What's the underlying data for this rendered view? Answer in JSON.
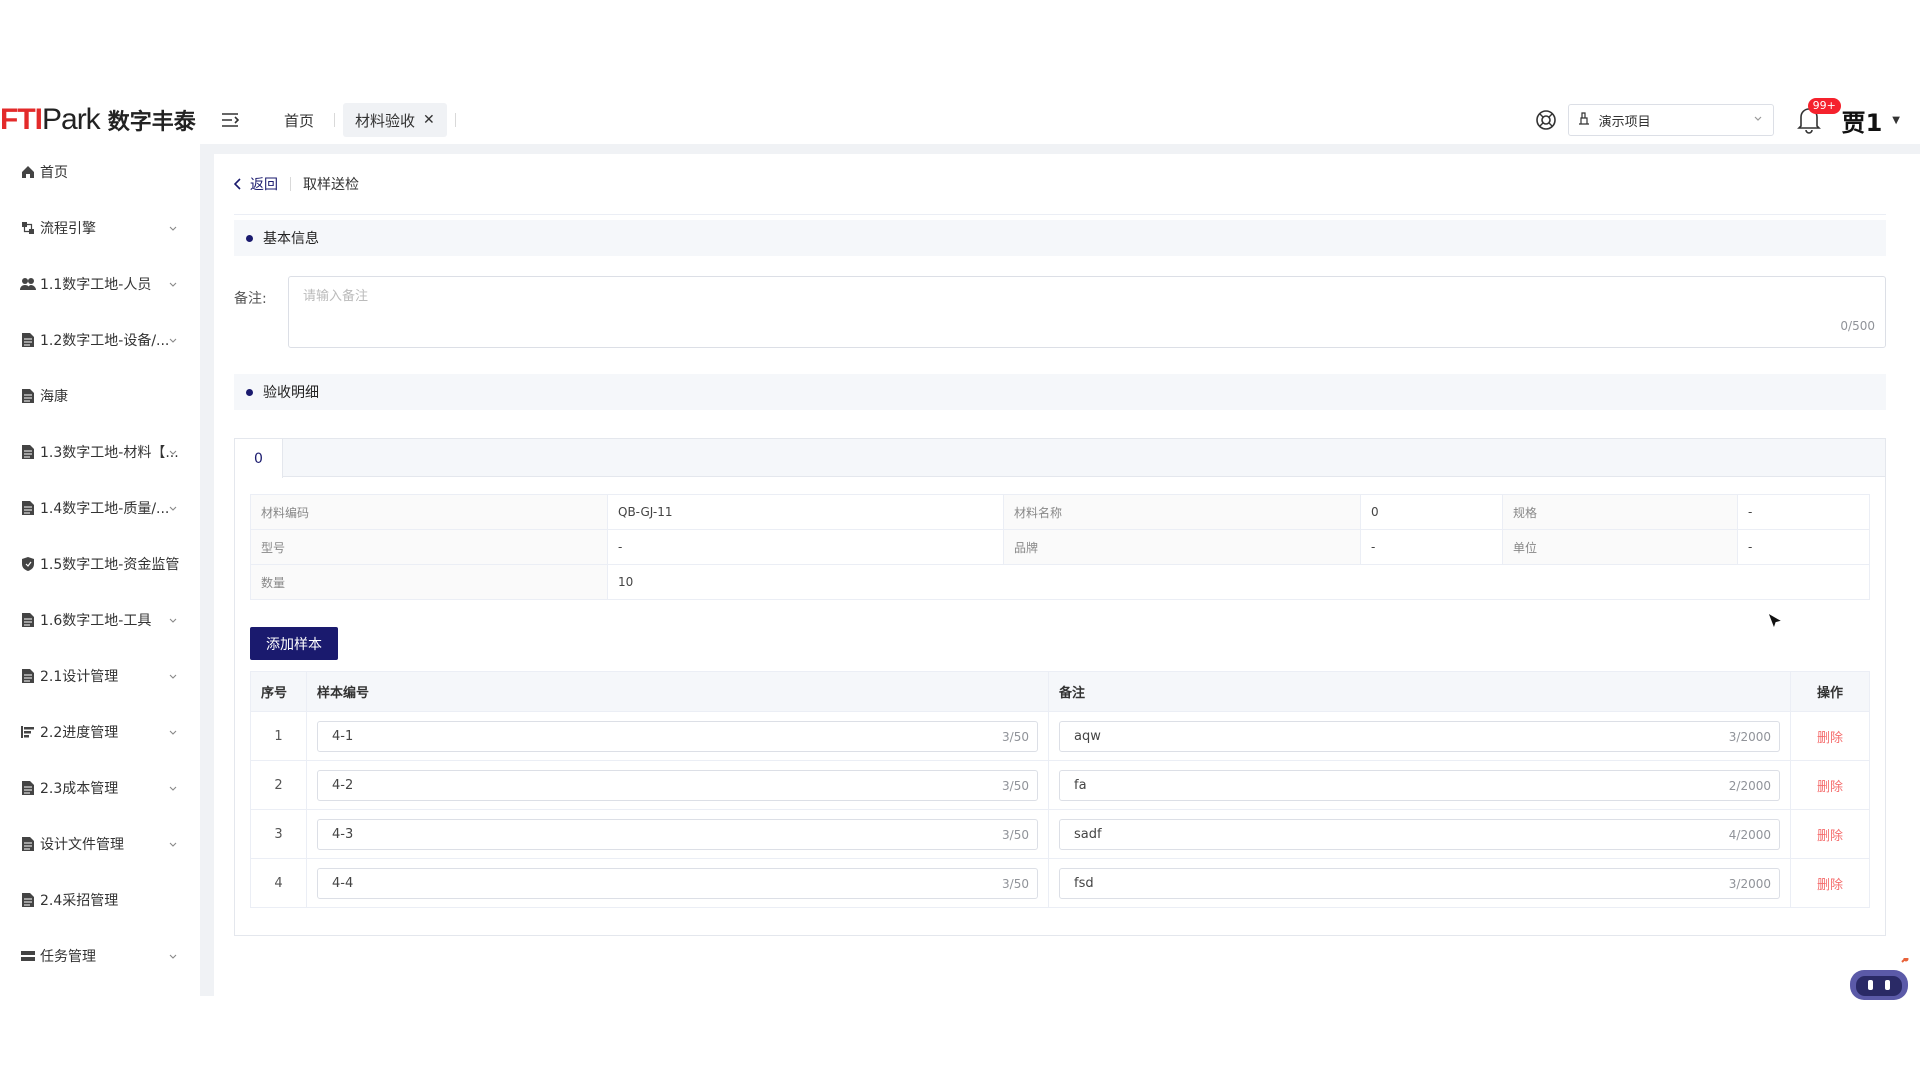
{
  "brand": {
    "logo_text": "FTI",
    "logo_park": "Park",
    "logo_cn": "数字丰泰"
  },
  "header": {
    "tabs": [
      {
        "label": "首页"
      },
      {
        "label": "材料验收"
      }
    ],
    "project_select": "演示项目",
    "notification_badge": "99+",
    "user_name": "贾1"
  },
  "sidebar": {
    "items": [
      {
        "label": "首页",
        "icon": "home-icon"
      },
      {
        "label": "流程引擎",
        "icon": "flow-icon"
      },
      {
        "label": "1.1数字工地-人员",
        "icon": "people-icon"
      },
      {
        "label": "1.2数字工地-设备/...",
        "icon": "doc-icon"
      },
      {
        "label": "海康",
        "icon": "doc-icon"
      },
      {
        "label": "1.3数字工地-材料【...",
        "icon": "doc-icon"
      },
      {
        "label": "1.4数字工地-质量/...",
        "icon": "doc-icon"
      },
      {
        "label": "1.5数字工地-资金监管",
        "icon": "shield-icon"
      },
      {
        "label": "1.6数字工地-工具",
        "icon": "doc-icon"
      },
      {
        "label": "2.1设计管理",
        "icon": "doc-icon"
      },
      {
        "label": "2.2进度管理",
        "icon": "progress-icon"
      },
      {
        "label": "2.3成本管理",
        "icon": "doc-icon"
      },
      {
        "label": "设计文件管理",
        "icon": "doc-icon"
      },
      {
        "label": "2.4采招管理",
        "icon": "doc-icon"
      },
      {
        "label": "任务管理",
        "icon": "task-icon"
      }
    ]
  },
  "page": {
    "back_label": "返回",
    "title": "取样送检",
    "basic_info": "基本信息",
    "remark_label": "备注:",
    "remark_placeholder": "请输入备注",
    "remark_count": "0/500",
    "detail_title": "验收明细",
    "detail_tab": "0",
    "info": {
      "material_code_k": "材料编码",
      "material_code_v": "QB-GJ-11",
      "material_name_k": "材料名称",
      "material_name_v": "0",
      "spec_k": "规格",
      "spec_v": "-",
      "model_k": "型号",
      "model_v": "-",
      "brand_k": "品牌",
      "brand_v": "-",
      "unit_k": "单位",
      "unit_v": "-",
      "qty_k": "数量",
      "qty_v": "10"
    },
    "add_sample_label": "添加样本",
    "table_headers": {
      "idx": "序号",
      "code": "样本编号",
      "remark": "备注",
      "op": "操作"
    },
    "rows": [
      {
        "idx": "1",
        "code": "4-1",
        "code_count": "3/50",
        "remark": "aqw",
        "remark_count": "3/2000",
        "op": "删除"
      },
      {
        "idx": "2",
        "code": "4-2",
        "code_count": "3/50",
        "remark": "fa",
        "remark_count": "2/2000",
        "op": "删除"
      },
      {
        "idx": "3",
        "code": "4-3",
        "code_count": "3/50",
        "remark": "sadf",
        "remark_count": "4/2000",
        "op": "删除"
      },
      {
        "idx": "4",
        "code": "4-4",
        "code_count": "3/50",
        "remark": "fsd",
        "remark_count": "3/2000",
        "op": "删除"
      }
    ]
  },
  "colors": {
    "primary": "#1a1a6e",
    "brand_red": "#e32a2a",
    "danger": "#f56c6c"
  }
}
